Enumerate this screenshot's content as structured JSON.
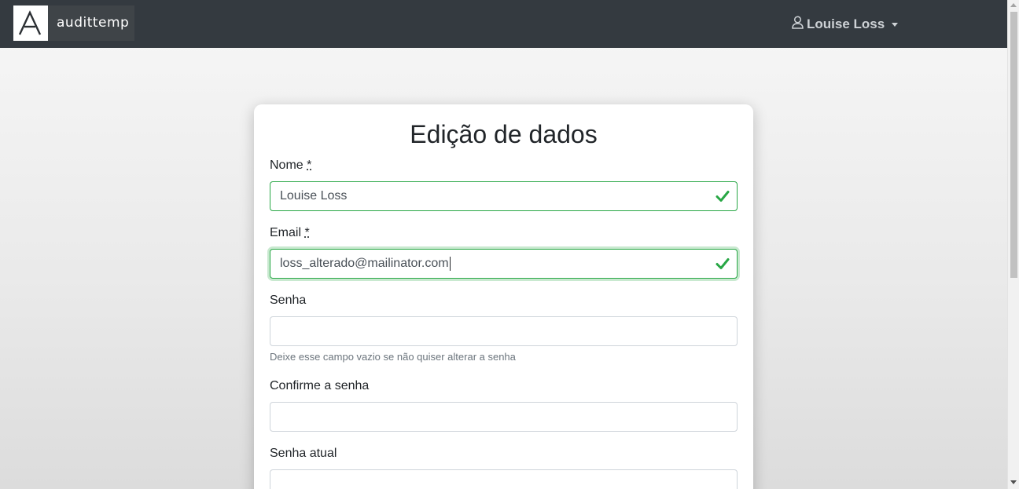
{
  "navbar": {
    "brand_name": "audittemp",
    "logo_icon": "audittemp-logo-icon",
    "user_icon": "user-icon",
    "user_name": "Louise Loss"
  },
  "form": {
    "title": "Edição de dados",
    "fields": {
      "nome": {
        "label": "Nome",
        "required_mark": "*",
        "value": "Louise Loss",
        "status": "valid"
      },
      "email": {
        "label": "Email",
        "required_mark": "*",
        "value": "loss_alterado@mailinator.com",
        "status": "valid"
      },
      "senha": {
        "label": "Senha",
        "value": "",
        "help": "Deixe esse campo vazio se não quiser alterar a senha"
      },
      "confirme": {
        "label": "Confirme a senha",
        "value": ""
      },
      "senha_atual": {
        "label": "Senha atual",
        "value": ""
      }
    }
  },
  "colors": {
    "navbar_bg": "#343a40",
    "valid_green": "#28a745"
  }
}
